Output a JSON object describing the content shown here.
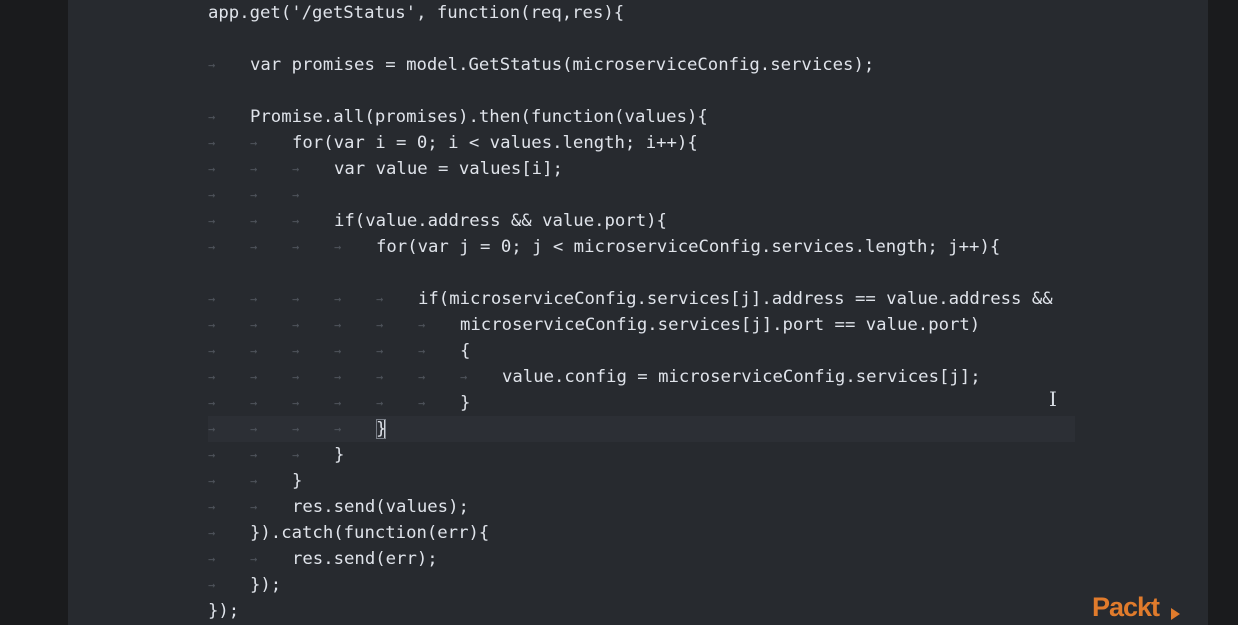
{
  "code_lines": [
    "app.get('/getStatus', function(req,res){",
    "",
    "var promises = model.GetStatus(microserviceConfig.services);",
    "",
    "Promise.all(promises).then(function(values){",
    "for(var i = 0; i < values.length; i++){",
    "var value = values[i];",
    "",
    "if(value.address && value.port){",
    "for(var j = 0; j < microserviceConfig.services.length; j++){",
    "",
    "if(microserviceConfig.services[j].address == value.address &&",
    "microserviceConfig.services[j].port == value.port)",
    "{",
    "value.config = microserviceConfig.services[j];",
    "}",
    "}",
    "}",
    "}",
    "res.send(values);",
    "}).catch(function(err){",
    "res.send(err);",
    "});",
    "});"
  ],
  "logo": {
    "text": "Packt"
  },
  "colors": {
    "background": "#272a2f",
    "keyword": "#8196c8",
    "string": "#b3c9e8",
    "logo": "#e07b2c"
  }
}
